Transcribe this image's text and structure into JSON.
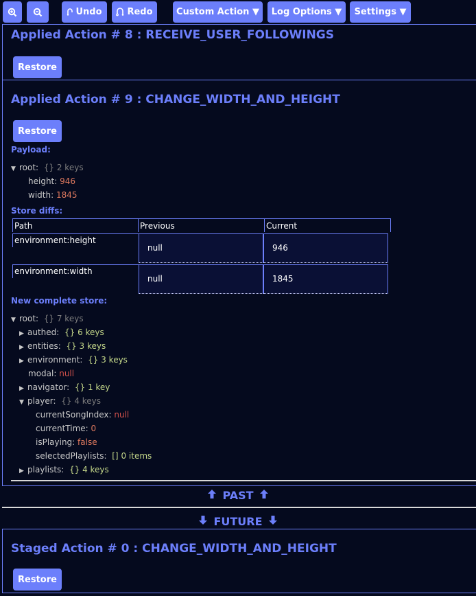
{
  "toolbar": {
    "zoom_in_icon": "zoom-in",
    "zoom_out_icon": "zoom-out",
    "undo_label": "Undo",
    "redo_label": "Redo",
    "custom_action_label": "Custom Action ▼",
    "log_options_label": "Log Options ▼",
    "settings_label": "Settings ▼"
  },
  "actions": [
    {
      "title": "Applied Action # 8 : RECEIVE_USER_FOLLOWINGS",
      "restore_label": "Restore"
    },
    {
      "title": "Applied Action # 9 : CHANGE_WIDTH_AND_HEIGHT",
      "restore_label": "Restore",
      "payload_label": "Payload:",
      "payload": {
        "root_key": "root:",
        "root_meta_brace": "{}",
        "root_meta": "2 keys",
        "entries": [
          {
            "key": "height:",
            "value": "946"
          },
          {
            "key": "width:",
            "value": "1845"
          }
        ]
      },
      "store_diffs_label": "Store diffs:",
      "diff_table": {
        "headers": [
          "Path",
          "Previous",
          "Current"
        ],
        "rows": [
          {
            "path": "environment:height",
            "previous": "null",
            "current": "946"
          },
          {
            "path": "environment:width",
            "previous": "null",
            "current": "1845"
          }
        ]
      },
      "new_store_label": "New complete store:",
      "store": {
        "root_key": "root:",
        "root_meta_brace": "{}",
        "root_meta": "7 keys",
        "entries": [
          {
            "key": "authed:",
            "brace": "{}",
            "meta": "6 keys",
            "collapsed": true
          },
          {
            "key": "entities:",
            "brace": "{}",
            "meta": "3 keys",
            "collapsed": true
          },
          {
            "key": "environment:",
            "brace": "{}",
            "meta": "3 keys",
            "collapsed": true
          },
          {
            "key": "modal:",
            "value": "null"
          },
          {
            "key": "navigator:",
            "brace": "{}",
            "meta": "1 key",
            "collapsed": true
          },
          {
            "key": "player:",
            "brace": "{}",
            "meta": "4 keys",
            "expanded": true
          },
          {
            "key": "playlists:",
            "brace": "{}",
            "meta": "4 keys",
            "collapsed": true
          }
        ],
        "player_children": [
          {
            "key": "currentSongIndex:",
            "value": "null"
          },
          {
            "key": "currentTime:",
            "value": "0"
          },
          {
            "key": "isPlaying:",
            "value": "false"
          },
          {
            "key": "selectedPlaylists:",
            "brace": "[]",
            "meta": "0 items"
          }
        ]
      }
    }
  ],
  "dividers": {
    "past": "PAST",
    "future": "FUTURE"
  },
  "staged": [
    {
      "title": "Staged Action # 0 : CHANGE_WIDTH_AND_HEIGHT",
      "restore_label": "Restore"
    }
  ],
  "colors": {
    "accent": "#6c7ffb",
    "background": "#050a1e",
    "number": "#e07a5f",
    "null": "#d0504a",
    "meta_green": "#c5d88a"
  }
}
